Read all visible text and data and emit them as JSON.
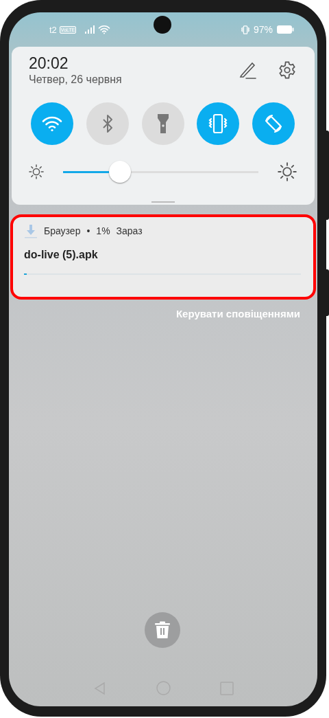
{
  "status_bar": {
    "carrier": "t2",
    "volte_badge": "VoLTE",
    "battery_percent": "97%"
  },
  "quick_panel": {
    "time": "20:02",
    "date": "Четвер, 26 червня",
    "tiles": [
      {
        "kind": "wifi",
        "on": true
      },
      {
        "kind": "bluetooth",
        "on": false
      },
      {
        "kind": "flashlight",
        "on": false
      },
      {
        "kind": "vibrate",
        "on": true
      },
      {
        "kind": "rotate",
        "on": true
      }
    ],
    "brightness": {
      "level": 0.29
    }
  },
  "notification": {
    "app": "Браузер",
    "separator": "•",
    "progress_text": "1%",
    "time": "Зараз",
    "title": "do-live (5).apk",
    "progress": {
      "level": 0.01
    },
    "highlighted": true
  },
  "manage_link": "Керувати сповіщеннями"
}
